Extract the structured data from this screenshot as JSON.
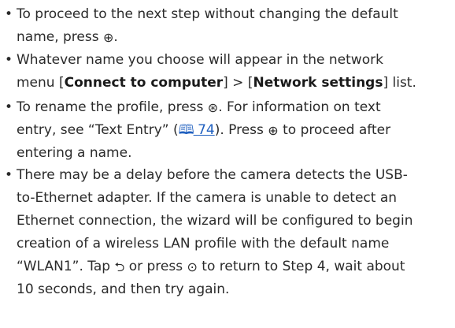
{
  "items": [
    {
      "line1": "To proceed to the next step without changing the default",
      "line2_text": "name, press",
      "line2_icon": "⊕",
      "line2_end": "."
    },
    {
      "line1": "Whatever name you choose will appear in the network",
      "line2_pre": "menu [",
      "line2_bold1": "Connect to computer",
      "line2_mid": "] > [",
      "line2_bold2": "Network settings",
      "line2_post": "] list."
    },
    {
      "line1_pre": "To rename the profile, press",
      "line1_icon": "⊛",
      "line1_post": ". For information on text",
      "line2_pre": "entry, see “Text Entry” (",
      "line2_link_icon": "🕮",
      "line2_link": "74",
      "line2_mid": "). Press",
      "line2_icon": "⊕",
      "line2_post": "to proceed after",
      "line3": "entering a name."
    },
    {
      "line1": "There may be a delay before the camera detects the USB-",
      "line2": "to-Ethernet adapter. If the camera is unable to detect an",
      "line3": "Ethernet connection, the wizard will be configured to begin",
      "line4": "creation of a wireless LAN profile with the default name",
      "line5_pre": "“WLAN1”. Tap",
      "line5_icon1": "⮌",
      "line5_mid": "or press",
      "line5_icon2": "⊙",
      "line5_post": "to return to Step 4, wait about",
      "line6": "10 seconds, and then try again."
    }
  ],
  "icons": {
    "ok_button": "ok-button-icon",
    "zoom_button": "zoom-in-button-icon",
    "return_touch": "return-icon",
    "multi_selector": "multi-selector-left-icon",
    "book": "book-icon"
  },
  "colors": {
    "text": "#2a2a2a",
    "link": "#1f5fbf"
  }
}
